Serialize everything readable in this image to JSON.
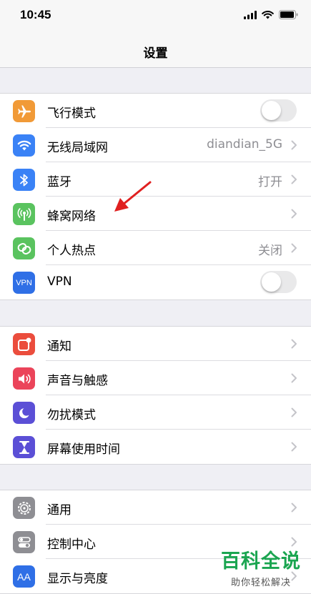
{
  "status": {
    "time": "10:45"
  },
  "nav": {
    "title": "设置"
  },
  "groups": [
    {
      "rows": [
        {
          "label": "飞行模式",
          "toggle": "off"
        },
        {
          "label": "无线局域网",
          "value": "diandian_5G"
        },
        {
          "label": "蓝牙",
          "value": "打开"
        },
        {
          "label": "蜂窝网络"
        },
        {
          "label": "个人热点",
          "value": "关闭"
        },
        {
          "label": "VPN",
          "icon_text": "VPN",
          "toggle": "off"
        }
      ]
    },
    {
      "rows": [
        {
          "label": "通知"
        },
        {
          "label": "声音与触感"
        },
        {
          "label": "勿扰模式"
        },
        {
          "label": "屏幕使用时间"
        }
      ]
    },
    {
      "rows": [
        {
          "label": "通用"
        },
        {
          "label": "控制中心"
        },
        {
          "label": "显示与亮度",
          "icon_text": "AA"
        }
      ]
    }
  ],
  "colors": {
    "airplane": "#f19a37",
    "wifi": "#3a82f6",
    "bluetooth": "#3a82f6",
    "cellular": "#5ac35f",
    "hotspot": "#5ac35f",
    "vpn": "#2f6fe6",
    "notifications": "#eb4d3d",
    "sounds": "#eb445a",
    "dnd": "#5b4fd6",
    "screentime": "#5b4fd6",
    "general": "#8e8e93",
    "control": "#8e8e93",
    "display": "#2f6fe6"
  },
  "watermark": {
    "title": "百科全说",
    "subtitle": "助你轻松解决"
  }
}
